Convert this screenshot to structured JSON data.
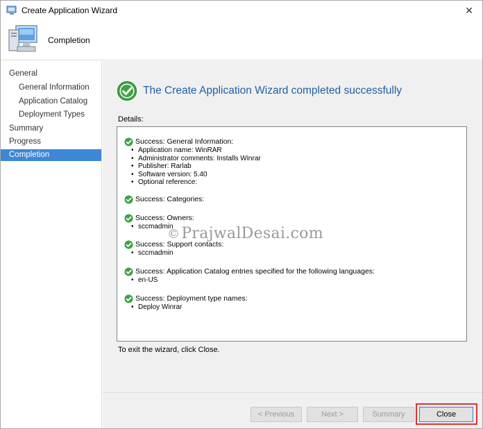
{
  "window": {
    "title": "Create Application Wizard",
    "close_symbol": "✕"
  },
  "header": {
    "title": "Completion",
    "icon": "computer-icon"
  },
  "nav": {
    "items": [
      {
        "label": "General"
      },
      {
        "label": "General Information"
      },
      {
        "label": "Application Catalog"
      },
      {
        "label": "Deployment Types"
      },
      {
        "label": "Summary"
      },
      {
        "label": "Progress"
      },
      {
        "label": "Completion"
      }
    ]
  },
  "main": {
    "title": "The Create Application Wizard completed successfully",
    "details_label": "Details:",
    "sections": [
      {
        "title": "Success: General Information:",
        "items": [
          "Application name: WinRAR",
          "Administrator comments: Installs Winrar",
          "Publisher: Rarlab",
          "Software version: 5.40",
          "Optional reference:"
        ]
      },
      {
        "title": "Success: Categories:",
        "items": []
      },
      {
        "title": "Success: Owners:",
        "items": [
          "sccmadmin"
        ]
      },
      {
        "title": "Success: Support contacts:",
        "items": [
          "sccmadmin"
        ]
      },
      {
        "title": "Success: Application Catalog entries specified for the following languages:",
        "items": [
          "en-US"
        ]
      },
      {
        "title": "Success: Deployment type names:",
        "items": [
          "Deploy Winrar"
        ]
      }
    ],
    "exit_text": "To exit the wizard, click Close.",
    "watermark": {
      "symbol": "©",
      "text": "PrajwalDesai.com"
    }
  },
  "footer": {
    "previous_label": "< Previous",
    "next_label": "Next >",
    "summary_label": "Summary",
    "close_label": "Close"
  },
  "colors": {
    "accent": "#3d87d6",
    "title_blue": "#1f5fa8",
    "success_green": "#2f9e34",
    "highlight_red": "#d93434"
  }
}
